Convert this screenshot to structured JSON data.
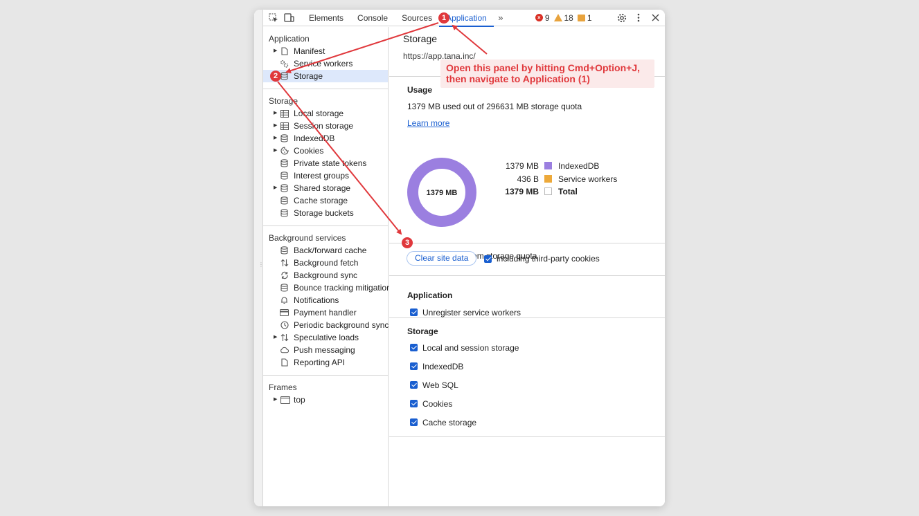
{
  "toolbar": {
    "tabs": [
      "Elements",
      "Console",
      "Sources",
      "Application"
    ],
    "active_tab": "Application",
    "errors": "9",
    "warnings": "18",
    "issues": "1"
  },
  "sidebar": {
    "application": {
      "title": "Application",
      "items": [
        "Manifest",
        "Service workers",
        "Storage"
      ]
    },
    "storage": {
      "title": "Storage",
      "items": [
        "Local storage",
        "Session storage",
        "IndexedDB",
        "Cookies",
        "Private state tokens",
        "Interest groups",
        "Shared storage",
        "Cache storage",
        "Storage buckets"
      ]
    },
    "background": {
      "title": "Background services",
      "items": [
        "Back/forward cache",
        "Background fetch",
        "Background sync",
        "Bounce tracking mitigations",
        "Notifications",
        "Payment handler",
        "Periodic background sync",
        "Speculative loads",
        "Push messaging",
        "Reporting API"
      ]
    },
    "frames": {
      "title": "Frames",
      "items": [
        "top"
      ]
    }
  },
  "main": {
    "title": "Storage",
    "origin": "https://app.tana.inc/",
    "usage": {
      "heading": "Usage",
      "text": "1379 MB used out of 296631 MB storage quota",
      "learn_more": "Learn more",
      "donut_label": "1379 MB",
      "legend": [
        {
          "value": "1379 MB",
          "name": "IndexedDB",
          "color": "#9b7fe0"
        },
        {
          "value": "436 B",
          "name": "Service workers",
          "color": "#eda93a"
        },
        {
          "value": "1379 MB",
          "name": "Total",
          "color": "#ffffff"
        }
      ],
      "simulate_label": "Simulate custom storage quota"
    },
    "clear": {
      "button": "Clear site data",
      "third_party_label": "including third-party cookies"
    },
    "application_group": {
      "heading": "Application",
      "items": [
        "Unregister service workers"
      ]
    },
    "storage_group": {
      "heading": "Storage",
      "items": [
        "Local and session storage",
        "IndexedDB",
        "Web SQL",
        "Cookies",
        "Cache storage"
      ]
    }
  },
  "annotation": {
    "text_line1": "Open this panel by hitting Cmd+Option+J,",
    "text_line2": "then navigate to Application (1)",
    "badges": [
      "1",
      "2",
      "3"
    ],
    "color": "#e0383c"
  }
}
